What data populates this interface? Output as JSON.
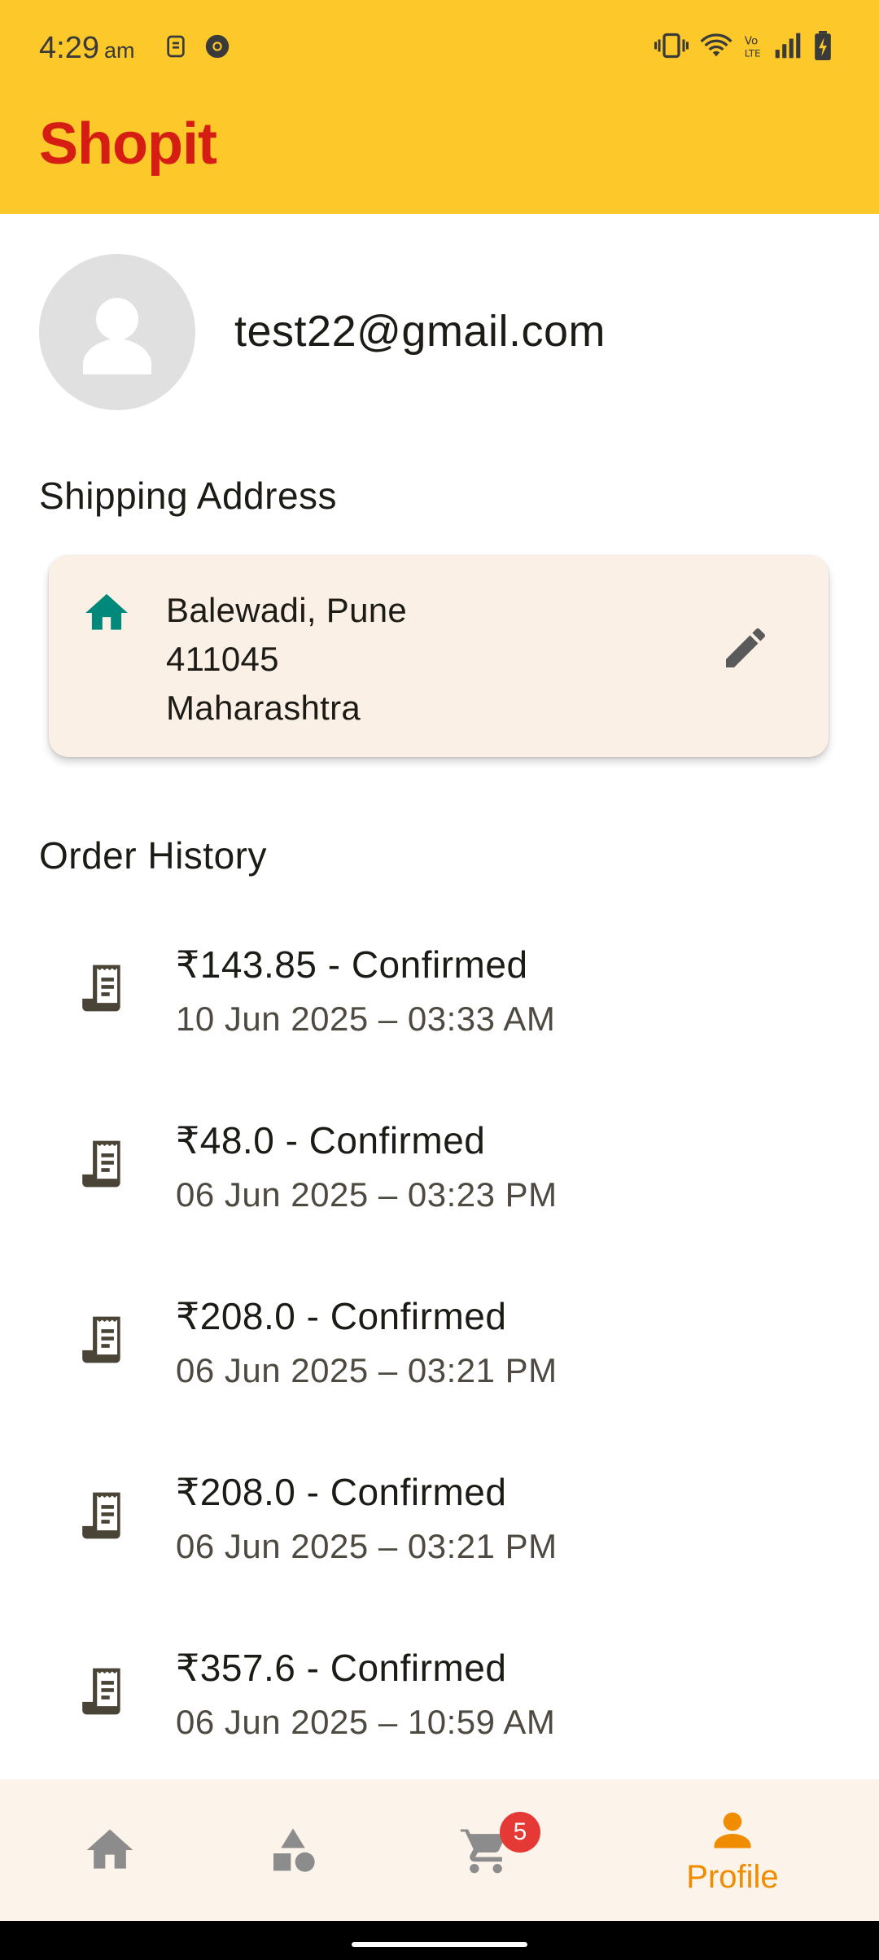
{
  "status_bar": {
    "time": "4:29",
    "ampm": "am"
  },
  "app": {
    "title": "Shopit",
    "accent": "#d51d14",
    "bar_color": "#fdc82a"
  },
  "profile": {
    "email": "test22@gmail.com"
  },
  "shipping": {
    "section_title": "Shipping Address",
    "line1": "Balewadi, Pune",
    "line2": "411045",
    "line3": "Maharashtra",
    "icon": "home-icon",
    "edit_icon": "edit-pencil-icon"
  },
  "orders": {
    "section_title": "Order History",
    "items": [
      {
        "title": "₹143.85 - Confirmed",
        "date": "10 Jun 2025 – 03:33 AM"
      },
      {
        "title": "₹48.0 - Confirmed",
        "date": "06 Jun 2025 – 03:23 PM"
      },
      {
        "title": "₹208.0 - Confirmed",
        "date": "06 Jun 2025 – 03:21 PM"
      },
      {
        "title": "₹208.0 - Confirmed",
        "date": "06 Jun 2025 – 03:21 PM"
      },
      {
        "title": "₹357.6 - Confirmed",
        "date": "06 Jun 2025 – 10:59 AM"
      }
    ]
  },
  "bottom_nav": {
    "items": [
      {
        "icon": "home-icon"
      },
      {
        "icon": "categories-icon"
      },
      {
        "icon": "cart-icon",
        "badge": "5"
      },
      {
        "icon": "profile-icon",
        "label": "Profile",
        "active": true
      }
    ],
    "active_color": "#f08c00",
    "inactive_color": "#8c8c8c"
  }
}
